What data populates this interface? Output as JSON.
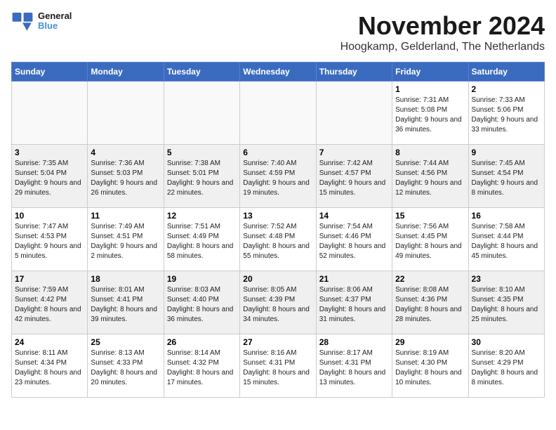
{
  "logo": {
    "line1": "General",
    "line2": "Blue"
  },
  "title": "November 2024",
  "location": "Hoogkamp, Gelderland, The Netherlands",
  "weekdays": [
    "Sunday",
    "Monday",
    "Tuesday",
    "Wednesday",
    "Thursday",
    "Friday",
    "Saturday"
  ],
  "weeks": [
    [
      {
        "day": "",
        "sunrise": "",
        "sunset": "",
        "daylight": ""
      },
      {
        "day": "",
        "sunrise": "",
        "sunset": "",
        "daylight": ""
      },
      {
        "day": "",
        "sunrise": "",
        "sunset": "",
        "daylight": ""
      },
      {
        "day": "",
        "sunrise": "",
        "sunset": "",
        "daylight": ""
      },
      {
        "day": "",
        "sunrise": "",
        "sunset": "",
        "daylight": ""
      },
      {
        "day": "1",
        "sunrise": "Sunrise: 7:31 AM",
        "sunset": "Sunset: 5:08 PM",
        "daylight": "Daylight: 9 hours and 36 minutes."
      },
      {
        "day": "2",
        "sunrise": "Sunrise: 7:33 AM",
        "sunset": "Sunset: 5:06 PM",
        "daylight": "Daylight: 9 hours and 33 minutes."
      }
    ],
    [
      {
        "day": "3",
        "sunrise": "Sunrise: 7:35 AM",
        "sunset": "Sunset: 5:04 PM",
        "daylight": "Daylight: 9 hours and 29 minutes."
      },
      {
        "day": "4",
        "sunrise": "Sunrise: 7:36 AM",
        "sunset": "Sunset: 5:03 PM",
        "daylight": "Daylight: 9 hours and 26 minutes."
      },
      {
        "day": "5",
        "sunrise": "Sunrise: 7:38 AM",
        "sunset": "Sunset: 5:01 PM",
        "daylight": "Daylight: 9 hours and 22 minutes."
      },
      {
        "day": "6",
        "sunrise": "Sunrise: 7:40 AM",
        "sunset": "Sunset: 4:59 PM",
        "daylight": "Daylight: 9 hours and 19 minutes."
      },
      {
        "day": "7",
        "sunrise": "Sunrise: 7:42 AM",
        "sunset": "Sunset: 4:57 PM",
        "daylight": "Daylight: 9 hours and 15 minutes."
      },
      {
        "day": "8",
        "sunrise": "Sunrise: 7:44 AM",
        "sunset": "Sunset: 4:56 PM",
        "daylight": "Daylight: 9 hours and 12 minutes."
      },
      {
        "day": "9",
        "sunrise": "Sunrise: 7:45 AM",
        "sunset": "Sunset: 4:54 PM",
        "daylight": "Daylight: 9 hours and 8 minutes."
      }
    ],
    [
      {
        "day": "10",
        "sunrise": "Sunrise: 7:47 AM",
        "sunset": "Sunset: 4:53 PM",
        "daylight": "Daylight: 9 hours and 5 minutes."
      },
      {
        "day": "11",
        "sunrise": "Sunrise: 7:49 AM",
        "sunset": "Sunset: 4:51 PM",
        "daylight": "Daylight: 9 hours and 2 minutes."
      },
      {
        "day": "12",
        "sunrise": "Sunrise: 7:51 AM",
        "sunset": "Sunset: 4:49 PM",
        "daylight": "Daylight: 8 hours and 58 minutes."
      },
      {
        "day": "13",
        "sunrise": "Sunrise: 7:52 AM",
        "sunset": "Sunset: 4:48 PM",
        "daylight": "Daylight: 8 hours and 55 minutes."
      },
      {
        "day": "14",
        "sunrise": "Sunrise: 7:54 AM",
        "sunset": "Sunset: 4:46 PM",
        "daylight": "Daylight: 8 hours and 52 minutes."
      },
      {
        "day": "15",
        "sunrise": "Sunrise: 7:56 AM",
        "sunset": "Sunset: 4:45 PM",
        "daylight": "Daylight: 8 hours and 49 minutes."
      },
      {
        "day": "16",
        "sunrise": "Sunrise: 7:58 AM",
        "sunset": "Sunset: 4:44 PM",
        "daylight": "Daylight: 8 hours and 45 minutes."
      }
    ],
    [
      {
        "day": "17",
        "sunrise": "Sunrise: 7:59 AM",
        "sunset": "Sunset: 4:42 PM",
        "daylight": "Daylight: 8 hours and 42 minutes."
      },
      {
        "day": "18",
        "sunrise": "Sunrise: 8:01 AM",
        "sunset": "Sunset: 4:41 PM",
        "daylight": "Daylight: 8 hours and 39 minutes."
      },
      {
        "day": "19",
        "sunrise": "Sunrise: 8:03 AM",
        "sunset": "Sunset: 4:40 PM",
        "daylight": "Daylight: 8 hours and 36 minutes."
      },
      {
        "day": "20",
        "sunrise": "Sunrise: 8:05 AM",
        "sunset": "Sunset: 4:39 PM",
        "daylight": "Daylight: 8 hours and 34 minutes."
      },
      {
        "day": "21",
        "sunrise": "Sunrise: 8:06 AM",
        "sunset": "Sunset: 4:37 PM",
        "daylight": "Daylight: 8 hours and 31 minutes."
      },
      {
        "day": "22",
        "sunrise": "Sunrise: 8:08 AM",
        "sunset": "Sunset: 4:36 PM",
        "daylight": "Daylight: 8 hours and 28 minutes."
      },
      {
        "day": "23",
        "sunrise": "Sunrise: 8:10 AM",
        "sunset": "Sunset: 4:35 PM",
        "daylight": "Daylight: 8 hours and 25 minutes."
      }
    ],
    [
      {
        "day": "24",
        "sunrise": "Sunrise: 8:11 AM",
        "sunset": "Sunset: 4:34 PM",
        "daylight": "Daylight: 8 hours and 23 minutes."
      },
      {
        "day": "25",
        "sunrise": "Sunrise: 8:13 AM",
        "sunset": "Sunset: 4:33 PM",
        "daylight": "Daylight: 8 hours and 20 minutes."
      },
      {
        "day": "26",
        "sunrise": "Sunrise: 8:14 AM",
        "sunset": "Sunset: 4:32 PM",
        "daylight": "Daylight: 8 hours and 17 minutes."
      },
      {
        "day": "27",
        "sunrise": "Sunrise: 8:16 AM",
        "sunset": "Sunset: 4:31 PM",
        "daylight": "Daylight: 8 hours and 15 minutes."
      },
      {
        "day": "28",
        "sunrise": "Sunrise: 8:17 AM",
        "sunset": "Sunset: 4:31 PM",
        "daylight": "Daylight: 8 hours and 13 minutes."
      },
      {
        "day": "29",
        "sunrise": "Sunrise: 8:19 AM",
        "sunset": "Sunset: 4:30 PM",
        "daylight": "Daylight: 8 hours and 10 minutes."
      },
      {
        "day": "30",
        "sunrise": "Sunrise: 8:20 AM",
        "sunset": "Sunset: 4:29 PM",
        "daylight": "Daylight: 8 hours and 8 minutes."
      }
    ]
  ]
}
